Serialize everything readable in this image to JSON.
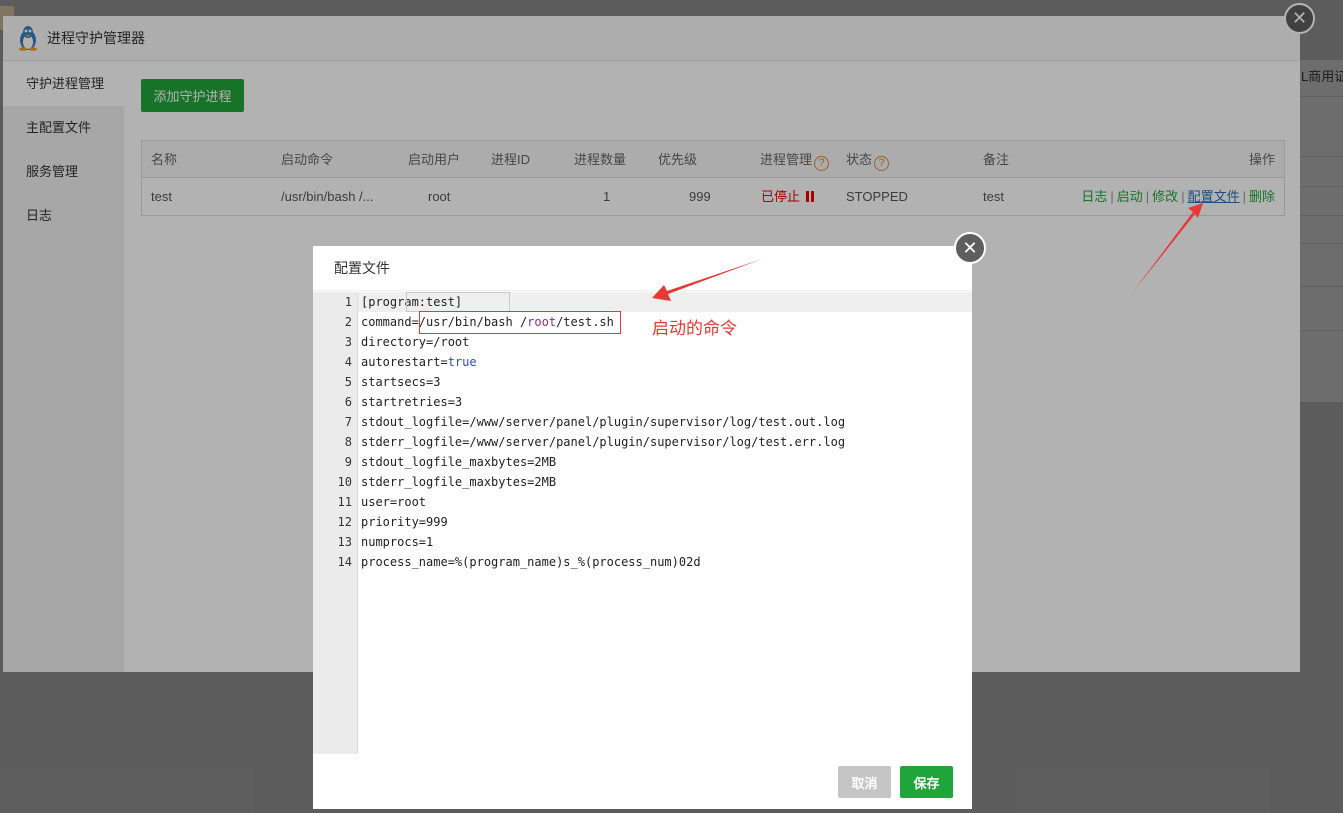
{
  "background": {
    "right_text": "L商用证"
  },
  "window": {
    "title": "进程守护管理器",
    "close_label": "✕",
    "sidebar": {
      "items": [
        {
          "label": "守护进程管理",
          "active": true
        },
        {
          "label": "主配置文件",
          "active": false
        },
        {
          "label": "服务管理",
          "active": false
        },
        {
          "label": "日志",
          "active": false
        }
      ]
    },
    "add_button": "添加守护进程",
    "table": {
      "headers": {
        "name": "名称",
        "command": "启动命令",
        "user": "启动用户",
        "pid": "进程ID",
        "count": "进程数量",
        "priority": "优先级",
        "manage": "进程管理",
        "status": "状态",
        "remark": "备注",
        "ops": "操作"
      },
      "help_icon": "?",
      "rows": [
        {
          "name": "test",
          "command": "/usr/bin/bash /...",
          "user": "root",
          "pid": "",
          "count": "1",
          "priority": "999",
          "manage": "已停止",
          "status": "STOPPED",
          "remark": "test",
          "ops": {
            "log": "日志",
            "start": "启动",
            "edit": "修改",
            "config": "配置文件",
            "delete": "删除",
            "separator": "|"
          }
        }
      ]
    }
  },
  "dialog": {
    "title": "配置文件",
    "close_label": "✕",
    "lines": [
      {
        "num": "1",
        "text": "[program:test]"
      },
      {
        "num": "2",
        "text": "command=/usr/bin/bash /root/test.sh"
      },
      {
        "num": "3",
        "text": "directory=/root"
      },
      {
        "num": "4",
        "text": "autorestart=true"
      },
      {
        "num": "5",
        "text": "startsecs=3"
      },
      {
        "num": "6",
        "text": "startretries=3"
      },
      {
        "num": "7",
        "text": "stdout_logfile=/www/server/panel/plugin/supervisor/log/test.out.log"
      },
      {
        "num": "8",
        "text": "stderr_logfile=/www/server/panel/plugin/supervisor/log/test.err.log"
      },
      {
        "num": "9",
        "text": "stdout_logfile_maxbytes=2MB"
      },
      {
        "num": "10",
        "text": "stderr_logfile_maxbytes=2MB"
      },
      {
        "num": "11",
        "text": "user=root"
      },
      {
        "num": "12",
        "text": "priority=999"
      },
      {
        "num": "13",
        "text": "numprocs=1"
      },
      {
        "num": "14",
        "text": "process_name=%(program_name)s_%(process_num)02d"
      }
    ],
    "cancel_button": "取消",
    "save_button": "保存"
  },
  "annotation": {
    "label": "启动的命令",
    "color": "#e53935"
  },
  "colors": {
    "accent_green": "#20a53a",
    "stopped_red": "#ee0000",
    "help_orange": "#e0893a"
  }
}
